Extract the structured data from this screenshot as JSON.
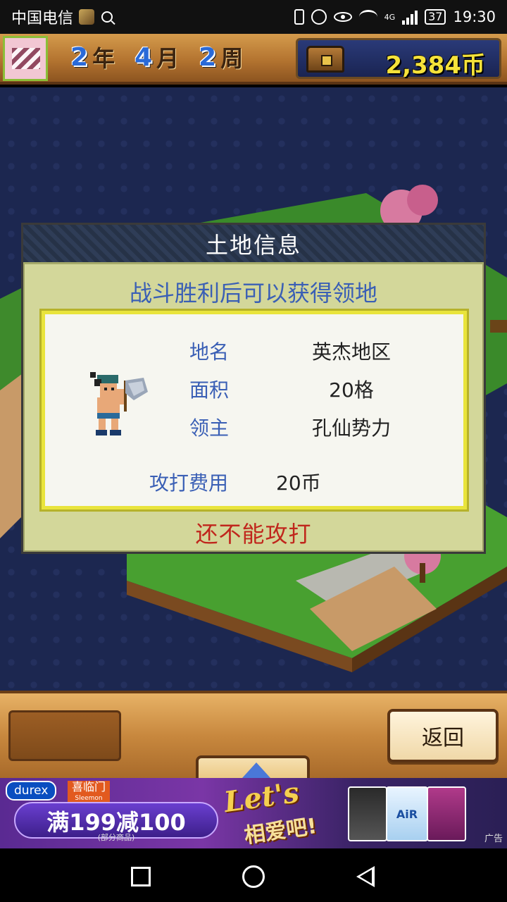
{
  "status_bar": {
    "carrier": "中国电信",
    "time": "19:30",
    "battery": "37",
    "network": "4G"
  },
  "header": {
    "year": "2",
    "year_unit": "年",
    "month": "4",
    "month_unit": "月",
    "week": "2",
    "week_unit": "周",
    "money": "2,384币"
  },
  "dialog": {
    "title": "土地信息",
    "subtitle": "战斗胜利后可以获得领地",
    "rows": [
      {
        "label": "地名",
        "value": "英杰地区"
      },
      {
        "label": "面积",
        "value": "20格"
      },
      {
        "label": "领主",
        "value": "孔仙势力"
      }
    ],
    "cost_label": "攻打费用",
    "cost_value": "20币",
    "status": "还不能攻打"
  },
  "bottom_bar": {
    "back_label": "返回"
  },
  "ad": {
    "brand1": "durex",
    "brand2": "喜临门",
    "brand2_sub": "Sleemon",
    "promo": "满199减100",
    "promo_note": "(部分商品)",
    "slogan1": "Let's",
    "slogan2": "相爱吧!",
    "product_air": "AiR",
    "ad_label": "广告"
  },
  "colors": {
    "label_blue": "#3a5fb5",
    "status_red": "#c0261c",
    "money_yellow": "#f5e23a"
  }
}
